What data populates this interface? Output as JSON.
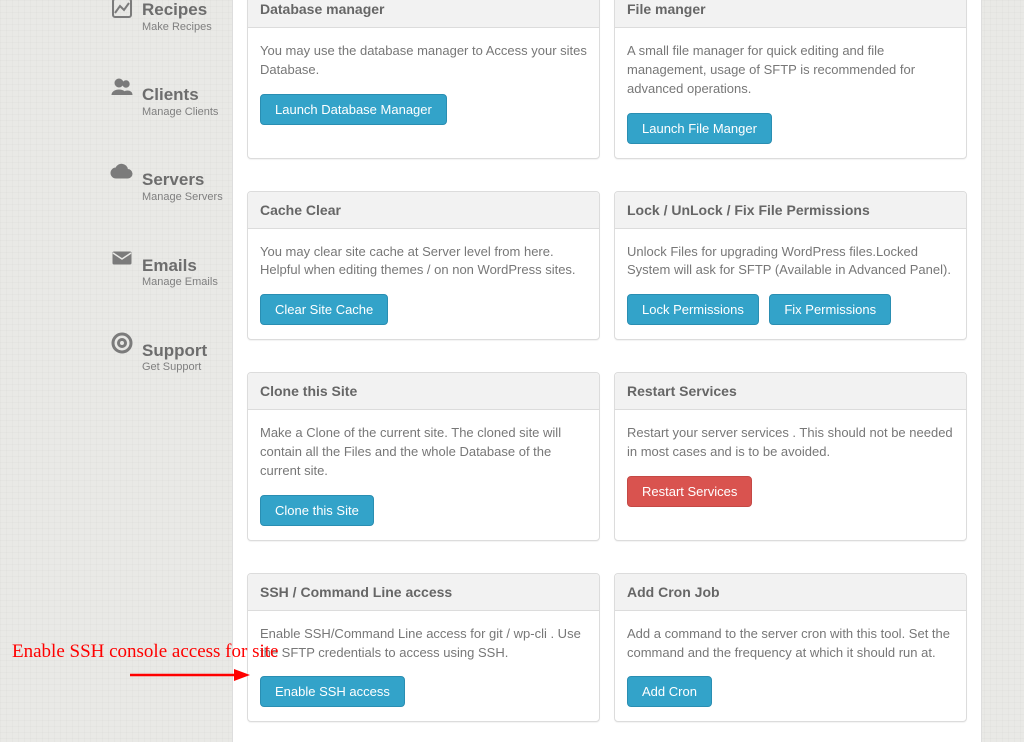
{
  "sidebar": {
    "items": [
      {
        "title": "Recipes",
        "sub": "Make Recipes"
      },
      {
        "title": "Clients",
        "sub": "Manage Clients"
      },
      {
        "title": "Servers",
        "sub": "Manage Servers"
      },
      {
        "title": "Emails",
        "sub": "Manage Emails"
      },
      {
        "title": "Support",
        "sub": "Get Support"
      }
    ]
  },
  "cards": {
    "db": {
      "title": "Database manager",
      "desc": "You may use the database manager to Access your sites Database.",
      "btn": "Launch Database Manager"
    },
    "file": {
      "title": "File manger",
      "desc": "A small file manager for quick editing and file management, usage of SFTP is recommended for advanced operations.",
      "btn": "Launch File Manger"
    },
    "cache": {
      "title": "Cache Clear",
      "desc": "You may clear site cache at Server level from here. Helpful when editing themes / on non WordPress sites.",
      "btn": "Clear Site Cache"
    },
    "lock": {
      "title": "Lock / UnLock / Fix File Permissions",
      "desc": "Unlock Files for upgrading WordPress files.Locked System will ask for SFTP (Available in Advanced Panel).",
      "btn1": "Lock Permissions",
      "btn2": "Fix Permissions"
    },
    "clone": {
      "title": "Clone this Site",
      "desc": "Make a Clone of the current site. The cloned site will contain all the Files and the whole Database of the current site.",
      "btn": "Clone this Site"
    },
    "restart": {
      "title": "Restart Services",
      "desc": "Restart your server services . This should not be needed in most cases and is to be avoided.",
      "btn": "Restart Services"
    },
    "ssh": {
      "title": "SSH / Command Line access",
      "desc": "Enable SSH/Command Line access for git / wp-cli . Use the SFTP credentials to access using SSH.",
      "btn": "Enable SSH access"
    },
    "cron": {
      "title": "Add Cron Job",
      "desc": "Add a command to the server cron with this tool. Set the command and the frequency at which it should run at.",
      "btn": "Add Cron"
    }
  },
  "annotation": {
    "text": "Enable SSH console access for site"
  }
}
